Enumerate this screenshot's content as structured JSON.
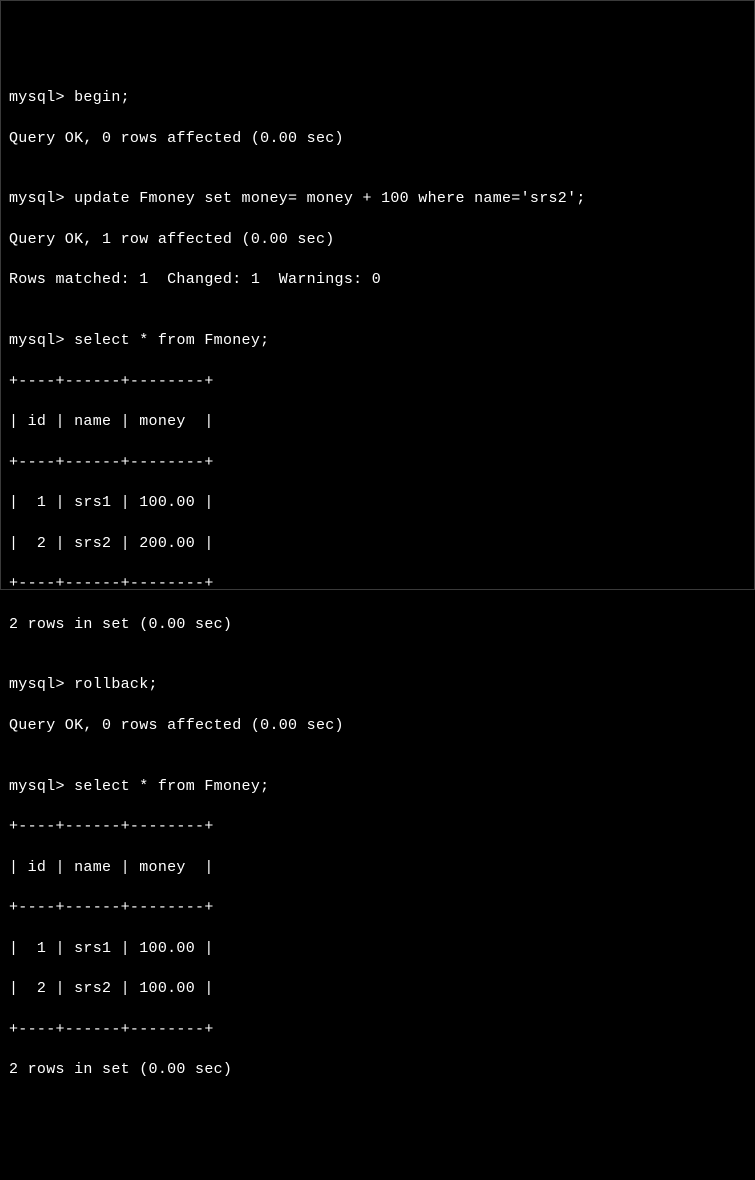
{
  "prompt": "mysql> ",
  "cmd1": "begin;",
  "resp1": "Query OK, 0 rows affected (0.00 sec)",
  "blank": "",
  "cmd2": "update Fmoney set money= money + 100 where name='srs2';",
  "resp2a": "Query OK, 1 row affected (0.00 sec)",
  "resp2b": "Rows matched: 1  Changed: 1  Warnings: 0",
  "cmd3": "select * from Fmoney;",
  "tbl_border": "+----+------+--------+",
  "tbl_header": "| id | name | money  |",
  "tbl1_row1": "|  1 | srs1 | 100.00 |",
  "tbl1_row2": "|  2 | srs2 | 200.00 |",
  "tbl_summary": "2 rows in set (0.00 sec)",
  "cmd4": "rollback;",
  "resp4": "Query OK, 0 rows affected (0.00 sec)",
  "cmd5": "select * from Fmoney;",
  "tbl2_row1": "|  1 | srs1 | 100.00 |",
  "tbl2_row2": "|  2 | srs2 | 100.00 |",
  "chart_data": {
    "type": "table",
    "tables": [
      {
        "title": "Fmoney (after update, before rollback)",
        "columns": [
          "id",
          "name",
          "money"
        ],
        "rows": [
          [
            1,
            "srs1",
            100.0
          ],
          [
            2,
            "srs2",
            200.0
          ]
        ]
      },
      {
        "title": "Fmoney (after rollback)",
        "columns": [
          "id",
          "name",
          "money"
        ],
        "rows": [
          [
            1,
            "srs1",
            100.0
          ],
          [
            2,
            "srs2",
            100.0
          ]
        ]
      }
    ]
  }
}
